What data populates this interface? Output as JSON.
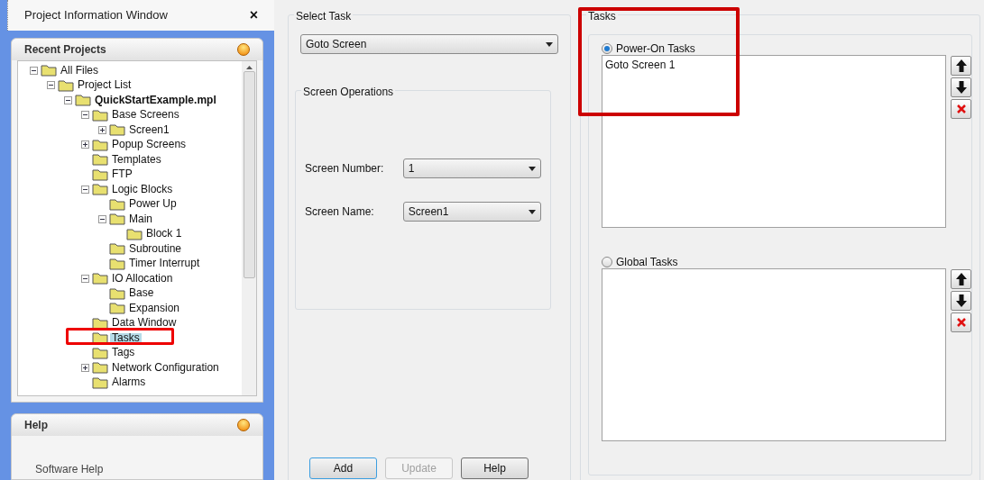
{
  "project_window": {
    "title": "Project Information Window",
    "close": "×",
    "recent_projects": {
      "title": "Recent Projects",
      "tree": [
        {
          "label": "All Files",
          "kind": "folder",
          "expanded": true,
          "selected": false,
          "children": [
            {
              "label": "Project List",
              "kind": "folder",
              "expanded": true,
              "selected": false,
              "children": [
                {
                  "label": "QuickStartExample.mpl",
                  "kind": "project",
                  "expanded": true,
                  "selected": false,
                  "children": [
                    {
                      "label": "Base Screens",
                      "kind": "folder",
                      "expanded": true,
                      "selected": false,
                      "children": [
                        {
                          "label": "Screen1",
                          "kind": "folder",
                          "expanded": false,
                          "selected": false
                        }
                      ]
                    },
                    {
                      "label": "Popup Screens",
                      "kind": "folder",
                      "expanded": false,
                      "selected": false
                    },
                    {
                      "label": "Templates",
                      "kind": "folder",
                      "selected": false
                    },
                    {
                      "label": "FTP",
                      "kind": "folder",
                      "selected": false
                    },
                    {
                      "label": "Logic Blocks",
                      "kind": "folder",
                      "expanded": true,
                      "selected": false,
                      "children": [
                        {
                          "label": "Power Up",
                          "kind": "folder",
                          "selected": false
                        },
                        {
                          "label": "Main",
                          "kind": "folder",
                          "expanded": true,
                          "selected": false,
                          "children": [
                            {
                              "label": "Block 1",
                              "kind": "folder",
                              "selected": false
                            }
                          ]
                        },
                        {
                          "label": "Subroutine",
                          "kind": "folder",
                          "selected": false
                        },
                        {
                          "label": "Timer Interrupt",
                          "kind": "folder",
                          "selected": false
                        }
                      ]
                    },
                    {
                      "label": "IO Allocation",
                      "kind": "folder",
                      "expanded": true,
                      "selected": false,
                      "children": [
                        {
                          "label": "Base",
                          "kind": "folder",
                          "selected": false
                        },
                        {
                          "label": "Expansion",
                          "kind": "folder",
                          "selected": false
                        }
                      ]
                    },
                    {
                      "label": "Data Window",
                      "kind": "folder",
                      "selected": false
                    },
                    {
                      "label": "Tasks",
                      "kind": "folder",
                      "selected": true
                    },
                    {
                      "label": "Tags",
                      "kind": "folder",
                      "selected": false
                    },
                    {
                      "label": "Network Configuration",
                      "kind": "folder",
                      "expanded": false,
                      "selected": false
                    },
                    {
                      "label": "Alarms",
                      "kind": "folder",
                      "selected": false
                    }
                  ]
                }
              ]
            }
          ]
        }
      ]
    },
    "help": {
      "title": "Help",
      "link": "Software Help"
    }
  },
  "select_task": {
    "title": "Select Task",
    "task": "Goto Screen",
    "screen_operations": {
      "title": "Screen Operations",
      "fields": [
        {
          "label": "Screen Number:",
          "value": "1"
        },
        {
          "label": "Screen Name:",
          "value": "Screen1"
        }
      ]
    },
    "buttons": [
      {
        "label": "Add",
        "disabled": false
      },
      {
        "label": "Update",
        "disabled": true
      },
      {
        "label": "Help",
        "disabled": false
      }
    ]
  },
  "tasks": {
    "title": "Tasks",
    "groups": [
      {
        "label": "Power-On Tasks",
        "selected": true,
        "items": [
          "Goto Screen 1"
        ]
      },
      {
        "label": "Global Tasks",
        "selected": false
      }
    ]
  }
}
